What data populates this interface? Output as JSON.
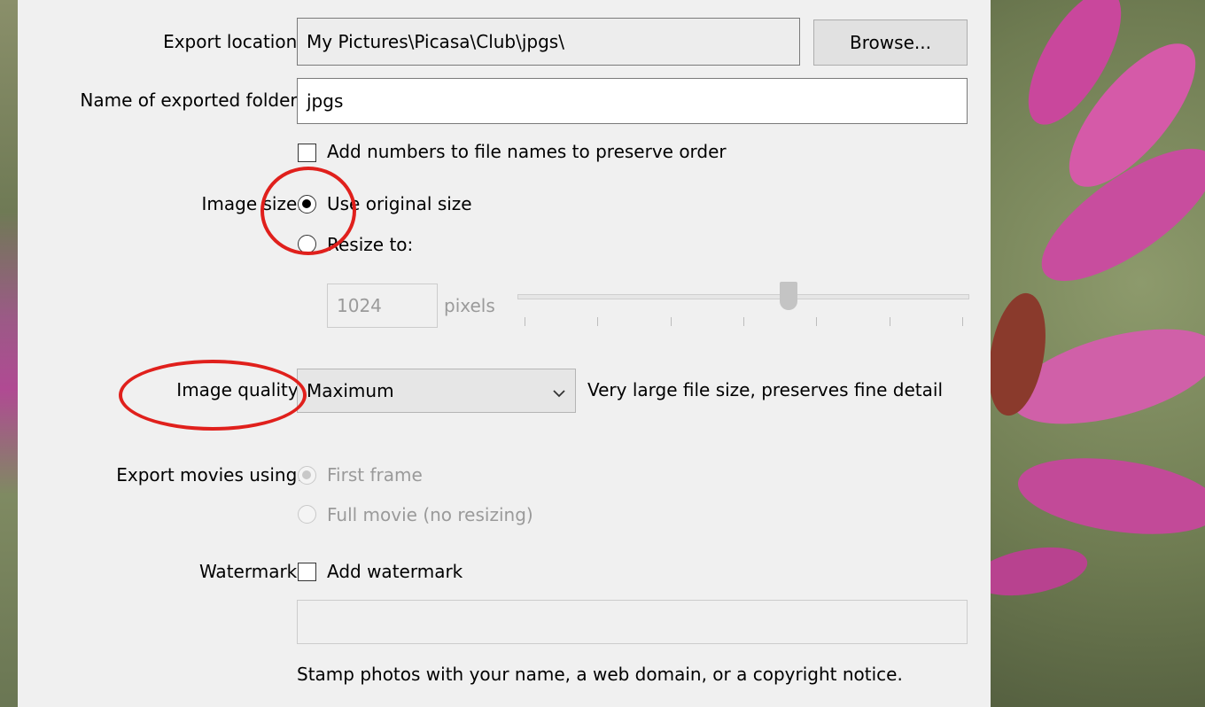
{
  "export_location": {
    "label": "Export location:",
    "value": "My Pictures\\Picasa\\Club\\jpgs\\",
    "browse_label": "Browse..."
  },
  "folder_name": {
    "label": "Name of exported folder:",
    "value": "jpgs"
  },
  "add_numbers": {
    "label": "Add numbers to file names to preserve order",
    "checked": false
  },
  "image_size": {
    "label": "Image size:",
    "options": [
      {
        "label": "Use original size",
        "selected": true
      },
      {
        "label": "Resize to:",
        "selected": false
      }
    ],
    "pixels_value": "1024",
    "pixels_unit": "pixels",
    "slider_fraction": 0.6
  },
  "image_quality": {
    "label": "Image quality:",
    "selected": "Maximum",
    "description": "Very large file size, preserves fine detail"
  },
  "export_movies": {
    "label": "Export movies using:",
    "options": [
      {
        "label": "First frame",
        "selected": true
      },
      {
        "label": "Full movie (no resizing)",
        "selected": false
      }
    ]
  },
  "watermark": {
    "label": "Watermark:",
    "checkbox_label": "Add watermark",
    "checked": false,
    "value": "",
    "hint": "Stamp photos with your name, a web domain, or a copyright notice."
  },
  "colors": {
    "annotation": "#e0201c",
    "dialog_bg": "#f0f0f0"
  }
}
